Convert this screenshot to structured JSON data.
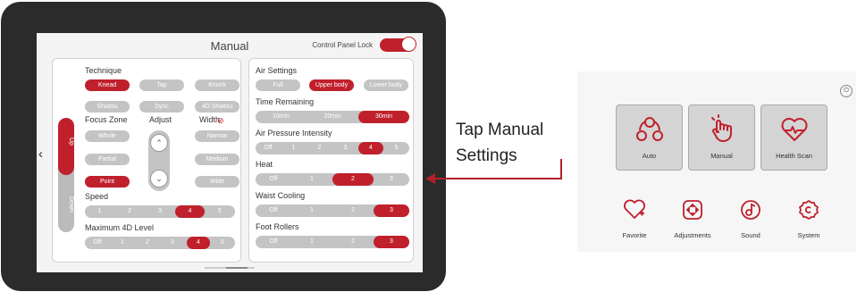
{
  "screen": {
    "title": "Manual",
    "control_panel_lock": "Control Panel Lock",
    "back_icon": "chevron-left-icon",
    "updown": {
      "up": "Up",
      "down": "Down"
    },
    "technique": {
      "label": "Technique",
      "options": [
        "Knead",
        "Tap",
        "Knock",
        "Shiatsu",
        "Sync",
        "4D Shiatsu"
      ],
      "selected": "Knead"
    },
    "focus_zone": {
      "label": "Focus Zone",
      "options": [
        "Whole",
        "Partial",
        "Point"
      ],
      "selected": "Point"
    },
    "adjust": {
      "label": "Adjust",
      "up_icon": "chevron-up-icon",
      "down_icon": "chevron-down-icon"
    },
    "width": {
      "label": "Width",
      "icon": "no-entry-icon",
      "options": [
        "Narrow",
        "Medium",
        "Wide"
      ]
    },
    "speed": {
      "label": "Speed",
      "options": [
        "1",
        "2",
        "3",
        "4",
        "5"
      ],
      "selected": "4"
    },
    "max_4d": {
      "label": "Maximum 4D Level",
      "options": [
        "Off",
        "1",
        "2",
        "3",
        "4",
        "5"
      ],
      "selected": "4"
    },
    "air_settings": {
      "label": "Air Settings",
      "options": [
        "Full",
        "Upper body",
        "Lower body"
      ],
      "selected": "Upper body"
    },
    "time_remaining": {
      "label": "Time Remaining",
      "options": [
        "10min",
        "20min",
        "30min"
      ],
      "selected": "30min"
    },
    "air_pressure": {
      "label": "Air Pressure Intensity",
      "options": [
        "Off",
        "1",
        "2",
        "3",
        "4",
        "5"
      ],
      "selected": "4"
    },
    "heat": {
      "label": "Heat",
      "options": [
        "Off",
        "1",
        "2",
        "3"
      ],
      "selected": "2"
    },
    "waist_cooling": {
      "label": "Waist Cooling",
      "options": [
        "Off",
        "1",
        "2",
        "3"
      ],
      "selected": "3"
    },
    "foot_rollers": {
      "label": "Foot Rollers",
      "options": [
        "Off",
        "1",
        "2",
        "3"
      ],
      "selected": "3"
    }
  },
  "annotation": {
    "line1": "Tap Manual",
    "line2": "Settings"
  },
  "control_panel": {
    "power_icon": "power-icon",
    "modes": [
      {
        "label": "Auto",
        "icon": "auto-icon"
      },
      {
        "label": "Manual",
        "icon": "hand-icon"
      },
      {
        "label": "Health Scan",
        "icon": "heart-pulse-icon"
      }
    ],
    "footer": [
      {
        "label": "Favorite",
        "icon": "heart-plus-icon"
      },
      {
        "label": "Adjustments",
        "icon": "adjust-icon"
      },
      {
        "label": "Sound",
        "icon": "music-note-icon"
      },
      {
        "label": "System",
        "icon": "gear-icon"
      }
    ]
  },
  "colors": {
    "accent": "#c0202c",
    "inactive": "#c4c4c4",
    "bezel": "#2b2b2b"
  }
}
